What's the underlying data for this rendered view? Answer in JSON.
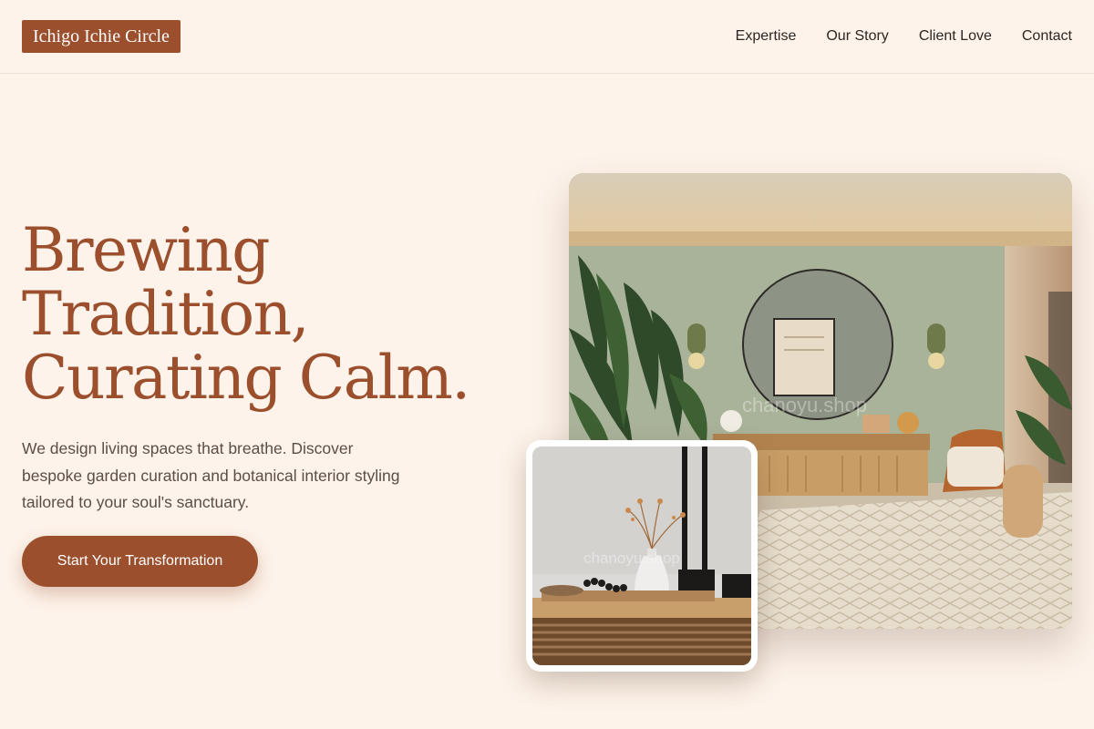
{
  "brand": {
    "name": "Ichigo Ichie Circle"
  },
  "nav": {
    "items": [
      "Expertise",
      "Our Story",
      "Client Love",
      "Contact"
    ]
  },
  "hero": {
    "headline_lines": [
      "Brewing",
      "Tradition,",
      "Curating Calm."
    ],
    "description": "We design living spaces that breathe. Discover bespoke garden curation and botanical interior styling tailored to your soul's sanctuary.",
    "cta_label": "Start Your Transformation"
  },
  "images": {
    "main_watermark": "chanoyu.shop",
    "inset_watermark": "chanoyu.shop"
  },
  "colors": {
    "accent": "#9b4f2d",
    "background": "#fdf3ea",
    "text": "#2b2623"
  }
}
